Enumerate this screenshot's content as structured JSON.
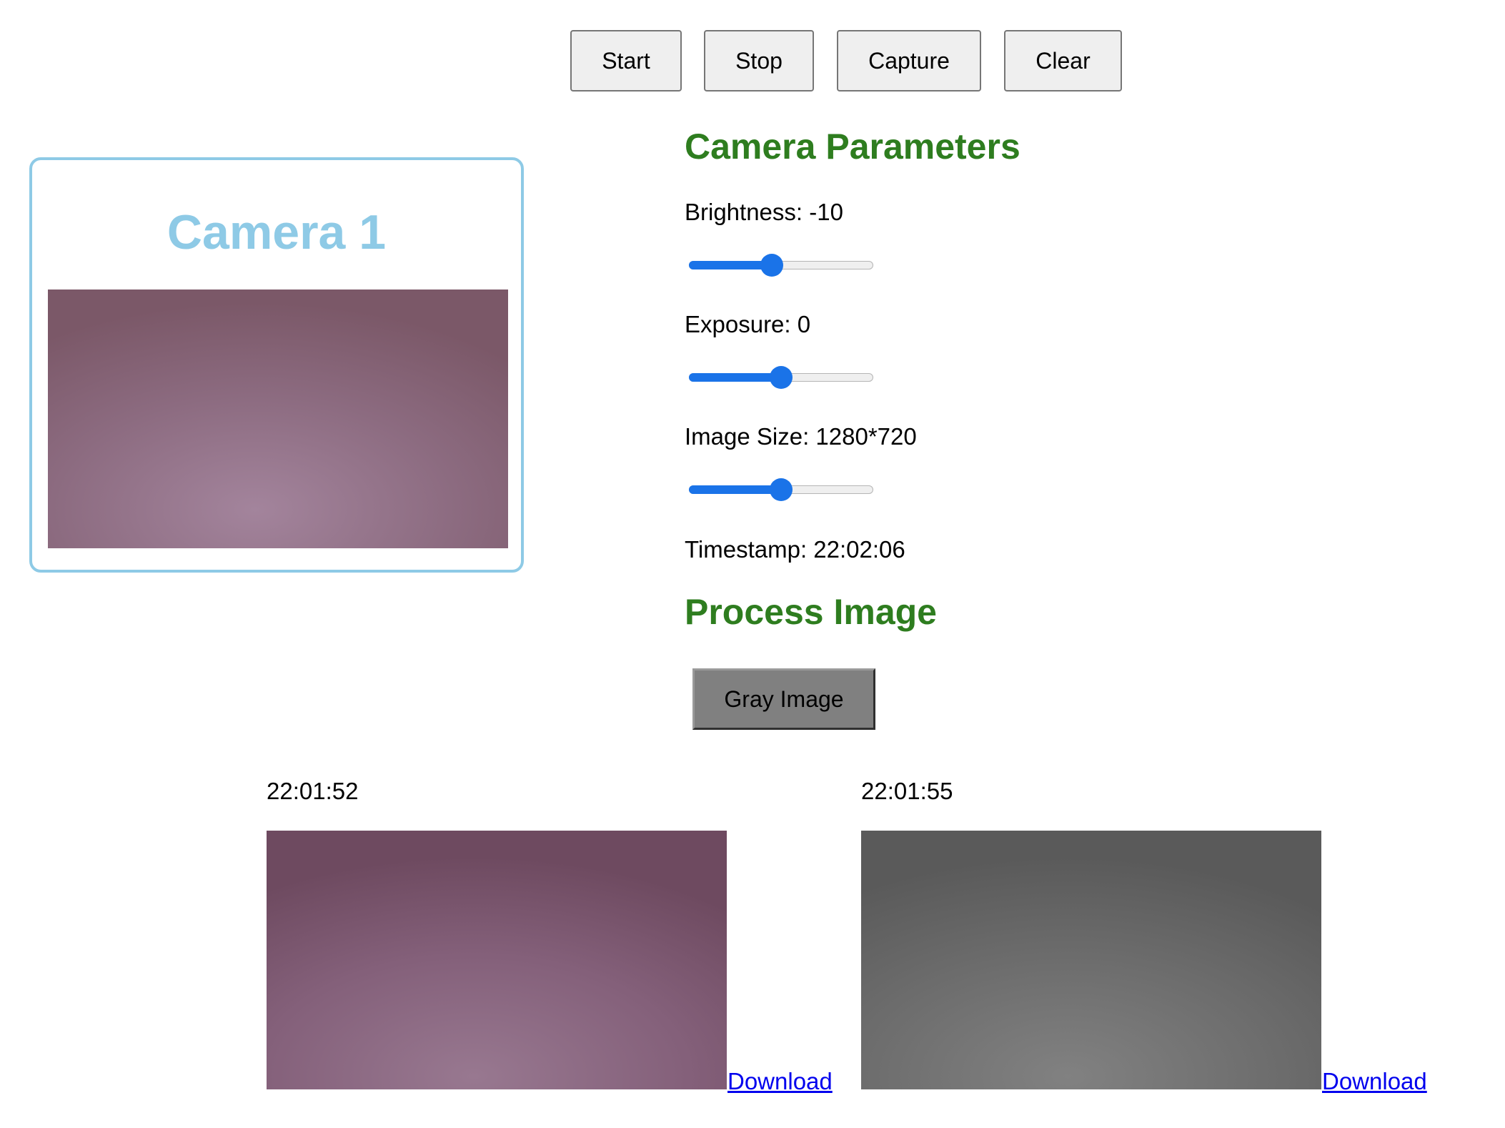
{
  "toolbar": {
    "start_label": "Start",
    "stop_label": "Stop",
    "capture_label": "Capture",
    "clear_label": "Clear"
  },
  "camera": {
    "title": "Camera 1",
    "feed_tint": "#8a6a80"
  },
  "params": {
    "heading": "Camera Parameters",
    "brightness_label": "Brightness: -10",
    "brightness_level": 0.45,
    "exposure_label": "Exposure: 0",
    "exposure_level": 0.5,
    "image_size_label": "Image Size: 1280*720",
    "image_size_level": 0.5,
    "timestamp_label": "Timestamp: 22:02:06"
  },
  "process": {
    "heading": "Process Image",
    "gray_button_label": "Gray Image"
  },
  "captures": [
    {
      "time": "22:01:52",
      "download_label": "Download",
      "style": "color"
    },
    {
      "time": "22:01:55",
      "download_label": "Download",
      "style": "gray"
    }
  ],
  "colors": {
    "accent_blue": "#1a73e8",
    "camera_border": "#8ecae6",
    "heading_green": "#2e7d1f",
    "link_blue": "#0000ee"
  }
}
